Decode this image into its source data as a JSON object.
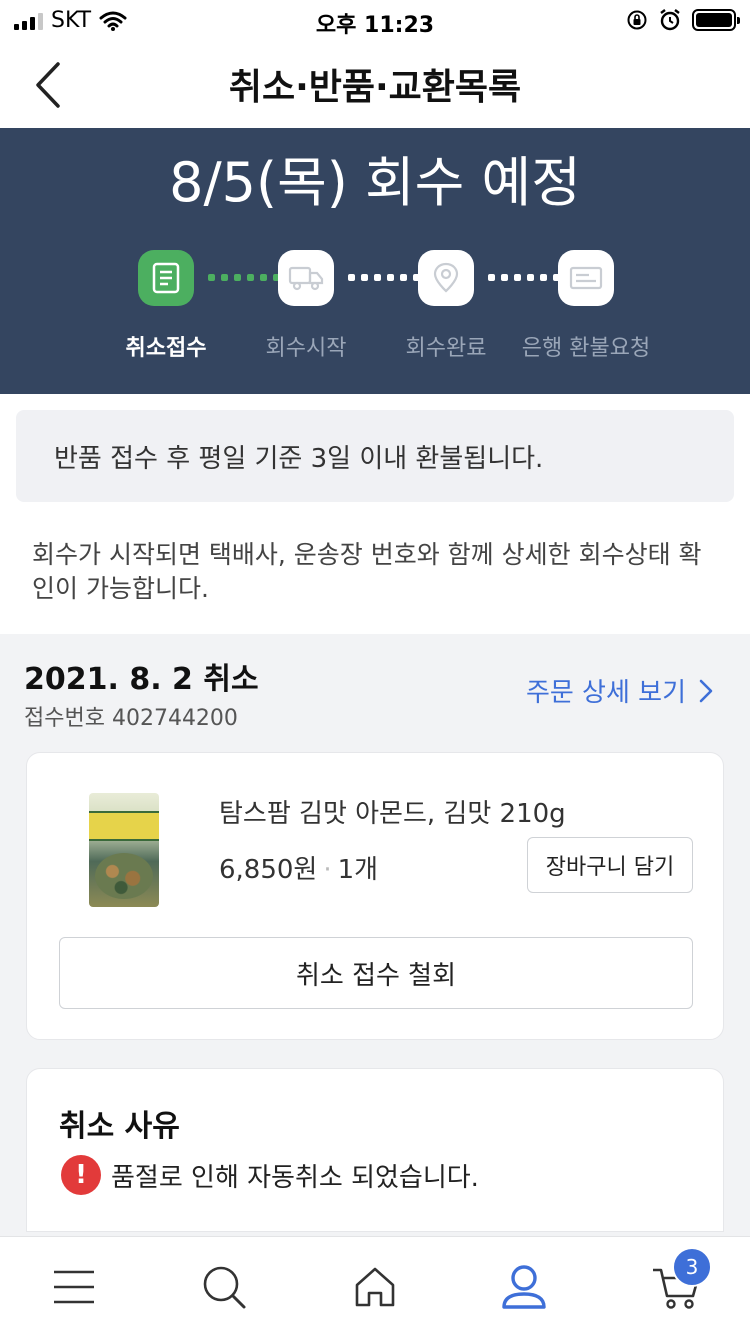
{
  "status_bar": {
    "carrier": "SKT",
    "time": "오후 11:23"
  },
  "header": {
    "title": "취소·반품·교환목록"
  },
  "hero": {
    "title": "8/5(목) 회수 예정",
    "steps": [
      {
        "label": "취소접수",
        "icon": "document-icon",
        "active": true
      },
      {
        "label": "회수시작",
        "icon": "truck-icon",
        "active": false
      },
      {
        "label": "회수완료",
        "icon": "location-pin-icon",
        "active": false
      },
      {
        "label": "은행 환불요청",
        "icon": "card-icon",
        "active": false
      }
    ]
  },
  "notice": {
    "text": "반품 접수 후 평일 기준 3일 이내 환불됩니다."
  },
  "info": {
    "text": "회수가 시작되면 택배사, 운송장 번호와 함께 상세한 회수상태 확인이 가능합니다."
  },
  "order": {
    "date_label": "2021. 8. 2 취소",
    "receipt_number": "접수번호 402744200",
    "detail_link": "주문 상세 보기",
    "product": {
      "name": "탐스팜 김맛 아몬드, 김맛 210g",
      "price": "6,850원",
      "quantity": "1개",
      "cart_button": "장바구니 담기"
    },
    "withdraw_button": "취소 접수 철회"
  },
  "reason": {
    "title": "취소 사유",
    "text": "품절로 인해 자동취소 되었습니다.",
    "icon": "!"
  },
  "bottom_nav": {
    "cart_count": "3"
  },
  "colors": {
    "hero_bg": "#344560",
    "active_green": "#4caf60",
    "link_blue": "#3e6fd8",
    "alert_red": "#e23a3a"
  }
}
